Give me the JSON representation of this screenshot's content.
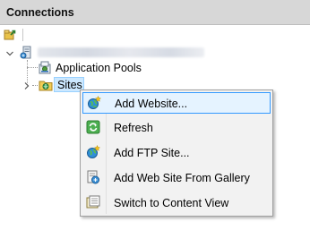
{
  "panel": {
    "title": "Connections"
  },
  "toolbar": {
    "buttons": [
      {
        "icon": "connect-icon"
      }
    ]
  },
  "tree": {
    "server": {
      "icon": "server-icon",
      "expanded": true
    },
    "nodes": [
      {
        "label": "Application Pools",
        "icon": "app-pools-icon",
        "expanded": false,
        "selected": false
      },
      {
        "label": "Sites",
        "icon": "sites-folder-icon",
        "expanded": false,
        "selected": true
      }
    ]
  },
  "context_menu": {
    "items": [
      {
        "label": "Add Website...",
        "icon": "add-website-icon",
        "highlighted": true
      },
      {
        "label": "Refresh",
        "icon": "refresh-icon",
        "highlighted": false
      },
      {
        "label": "Add FTP Site...",
        "icon": "add-ftp-site-icon",
        "highlighted": false
      },
      {
        "label": "Add Web Site From Gallery",
        "icon": "gallery-icon",
        "highlighted": false
      },
      {
        "label": "Switch to Content View",
        "icon": "content-view-icon",
        "highlighted": false
      }
    ]
  },
  "colors": {
    "header_bg": "#d7d7d7",
    "selection_bg": "#cce8ff",
    "selection_border": "#99d1ff",
    "menu_bg": "#f2f2f2",
    "menu_highlight_bg": "#e5f3ff",
    "menu_highlight_border": "#3399ff"
  }
}
